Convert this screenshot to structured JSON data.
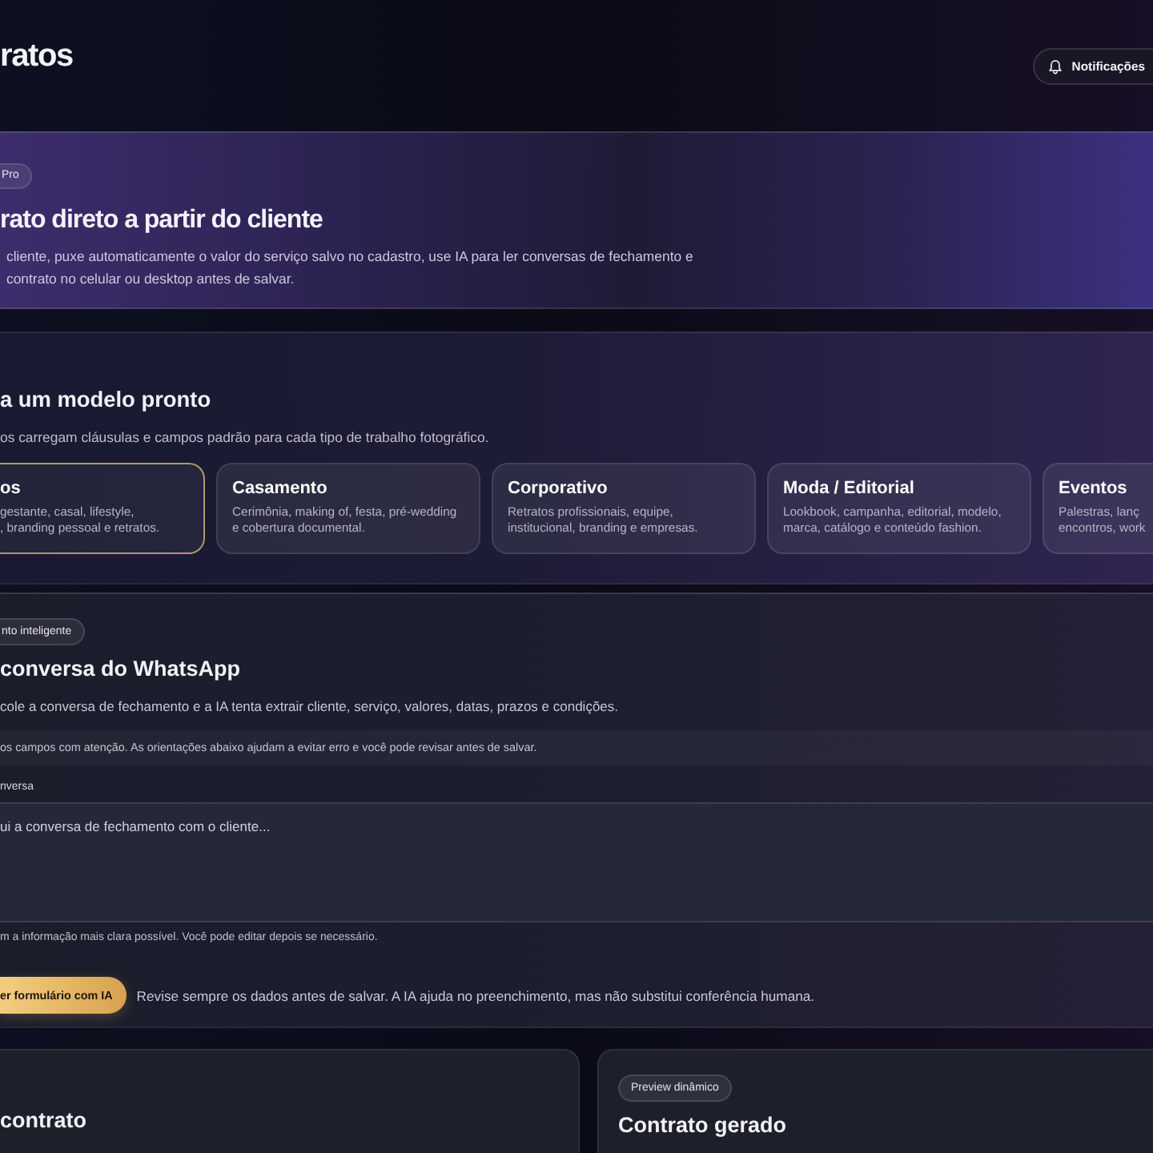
{
  "header": {
    "title": "ratos",
    "notifications_button": {
      "label": "Notificações"
    }
  },
  "hero": {
    "badge": "Pro",
    "heading": "rato direto a partir do cliente",
    "lines": [
      "cliente, puxe automaticamente o valor do serviço salvo no cadastro, use IA para ler conversas de fechamento e",
      "contrato no celular ou desktop antes de salvar."
    ]
  },
  "templates": {
    "heading": "a um modelo pronto",
    "subtitle": "os carregam cláusulas e campos padrão para cada tipo de trabalho fotográfico.",
    "cards": [
      {
        "kind": "cut_left",
        "title": "os",
        "lines": [
          "gestante, casal, lifestyle,",
          ", branding pessoal e retratos."
        ],
        "selected": true
      },
      {
        "kind": "full",
        "title": "Casamento",
        "lines": [
          "Cerimônia, making of, festa, pré-wedding",
          "e cobertura documental."
        ],
        "selected": false
      },
      {
        "kind": "full",
        "title": "Corporativo",
        "lines": [
          "Retratos profissionais, equipe,",
          "institucional, branding e empresas."
        ],
        "selected": false
      },
      {
        "kind": "full",
        "title": "Moda / Editorial",
        "lines": [
          "Lookbook, campanha, editorial, modelo,",
          "marca, catálogo e conteúdo fashion."
        ],
        "selected": false
      },
      {
        "kind": "cut_right",
        "title": "Eventos",
        "lines": [
          "Palestras, lanç",
          "encontros, work"
        ],
        "selected": false
      }
    ]
  },
  "whatsapp": {
    "badge": "nto inteligente",
    "heading": "conversa do WhatsApp",
    "description": "cole a conversa de fechamento e a IA tenta extrair cliente, serviço, valores, datas, prazos e condições.",
    "notice": "os campos com atenção. As orientações abaixo ajudam a evitar erro e você pode revisar antes de salvar.",
    "field_label": "nversa",
    "textarea": {
      "placeholder": "ui a conversa de fechamento com o cliente..."
    },
    "hint": "m a informação mais clara possível. Você pode editar depois se necessário.",
    "fill_button": {
      "label": "er formulário com IA"
    },
    "disclaimer": "Revise sempre os dados antes de salvar. A IA ajuda no preenchimento, mas não substitui conferência humana."
  },
  "panels": [
    {
      "kind": "cut_left",
      "heading": "contrato"
    },
    {
      "kind": "cut_right",
      "badge": "Preview dinâmico",
      "heading": "Contrato gerado"
    }
  ]
}
